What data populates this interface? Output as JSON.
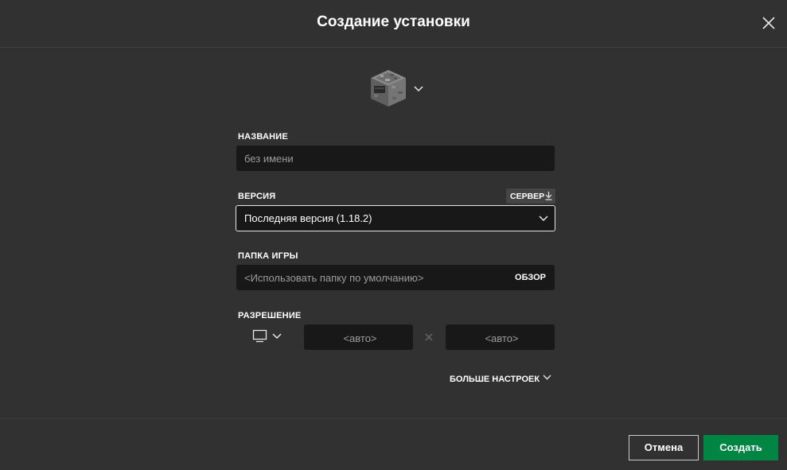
{
  "dialog": {
    "title": "Создание установки"
  },
  "name_field": {
    "label": "НАЗВАНИЕ",
    "placeholder": "без имени",
    "value": ""
  },
  "version_field": {
    "label": "ВЕРСИЯ",
    "server_button": "СЕРВЕР",
    "selected": "Последняя версия (1.18.2)"
  },
  "game_folder": {
    "label": "ПАПКА ИГРЫ",
    "placeholder": "<Использовать папку по умолчанию>",
    "browse_label": "ОБЗОР"
  },
  "resolution": {
    "label": "РАЗРЕШЕНИЕ",
    "width_placeholder": "<авто>",
    "height_placeholder": "<авто>"
  },
  "more_settings": {
    "label": "БОЛЬШЕ НАСТРОЕК"
  },
  "footer": {
    "cancel_label": "Отмена",
    "create_label": "Создать"
  },
  "icons": {
    "close": "close-icon",
    "installation_icon": "furnace-block-icon",
    "chevron": "chevron-down-icon",
    "download": "download-icon",
    "monitor": "monitor-icon",
    "times": "times-icon"
  },
  "colors": {
    "background": "#313131",
    "field_background": "#181818",
    "accent_green": "#008542",
    "server_button_bg": "#454545"
  }
}
